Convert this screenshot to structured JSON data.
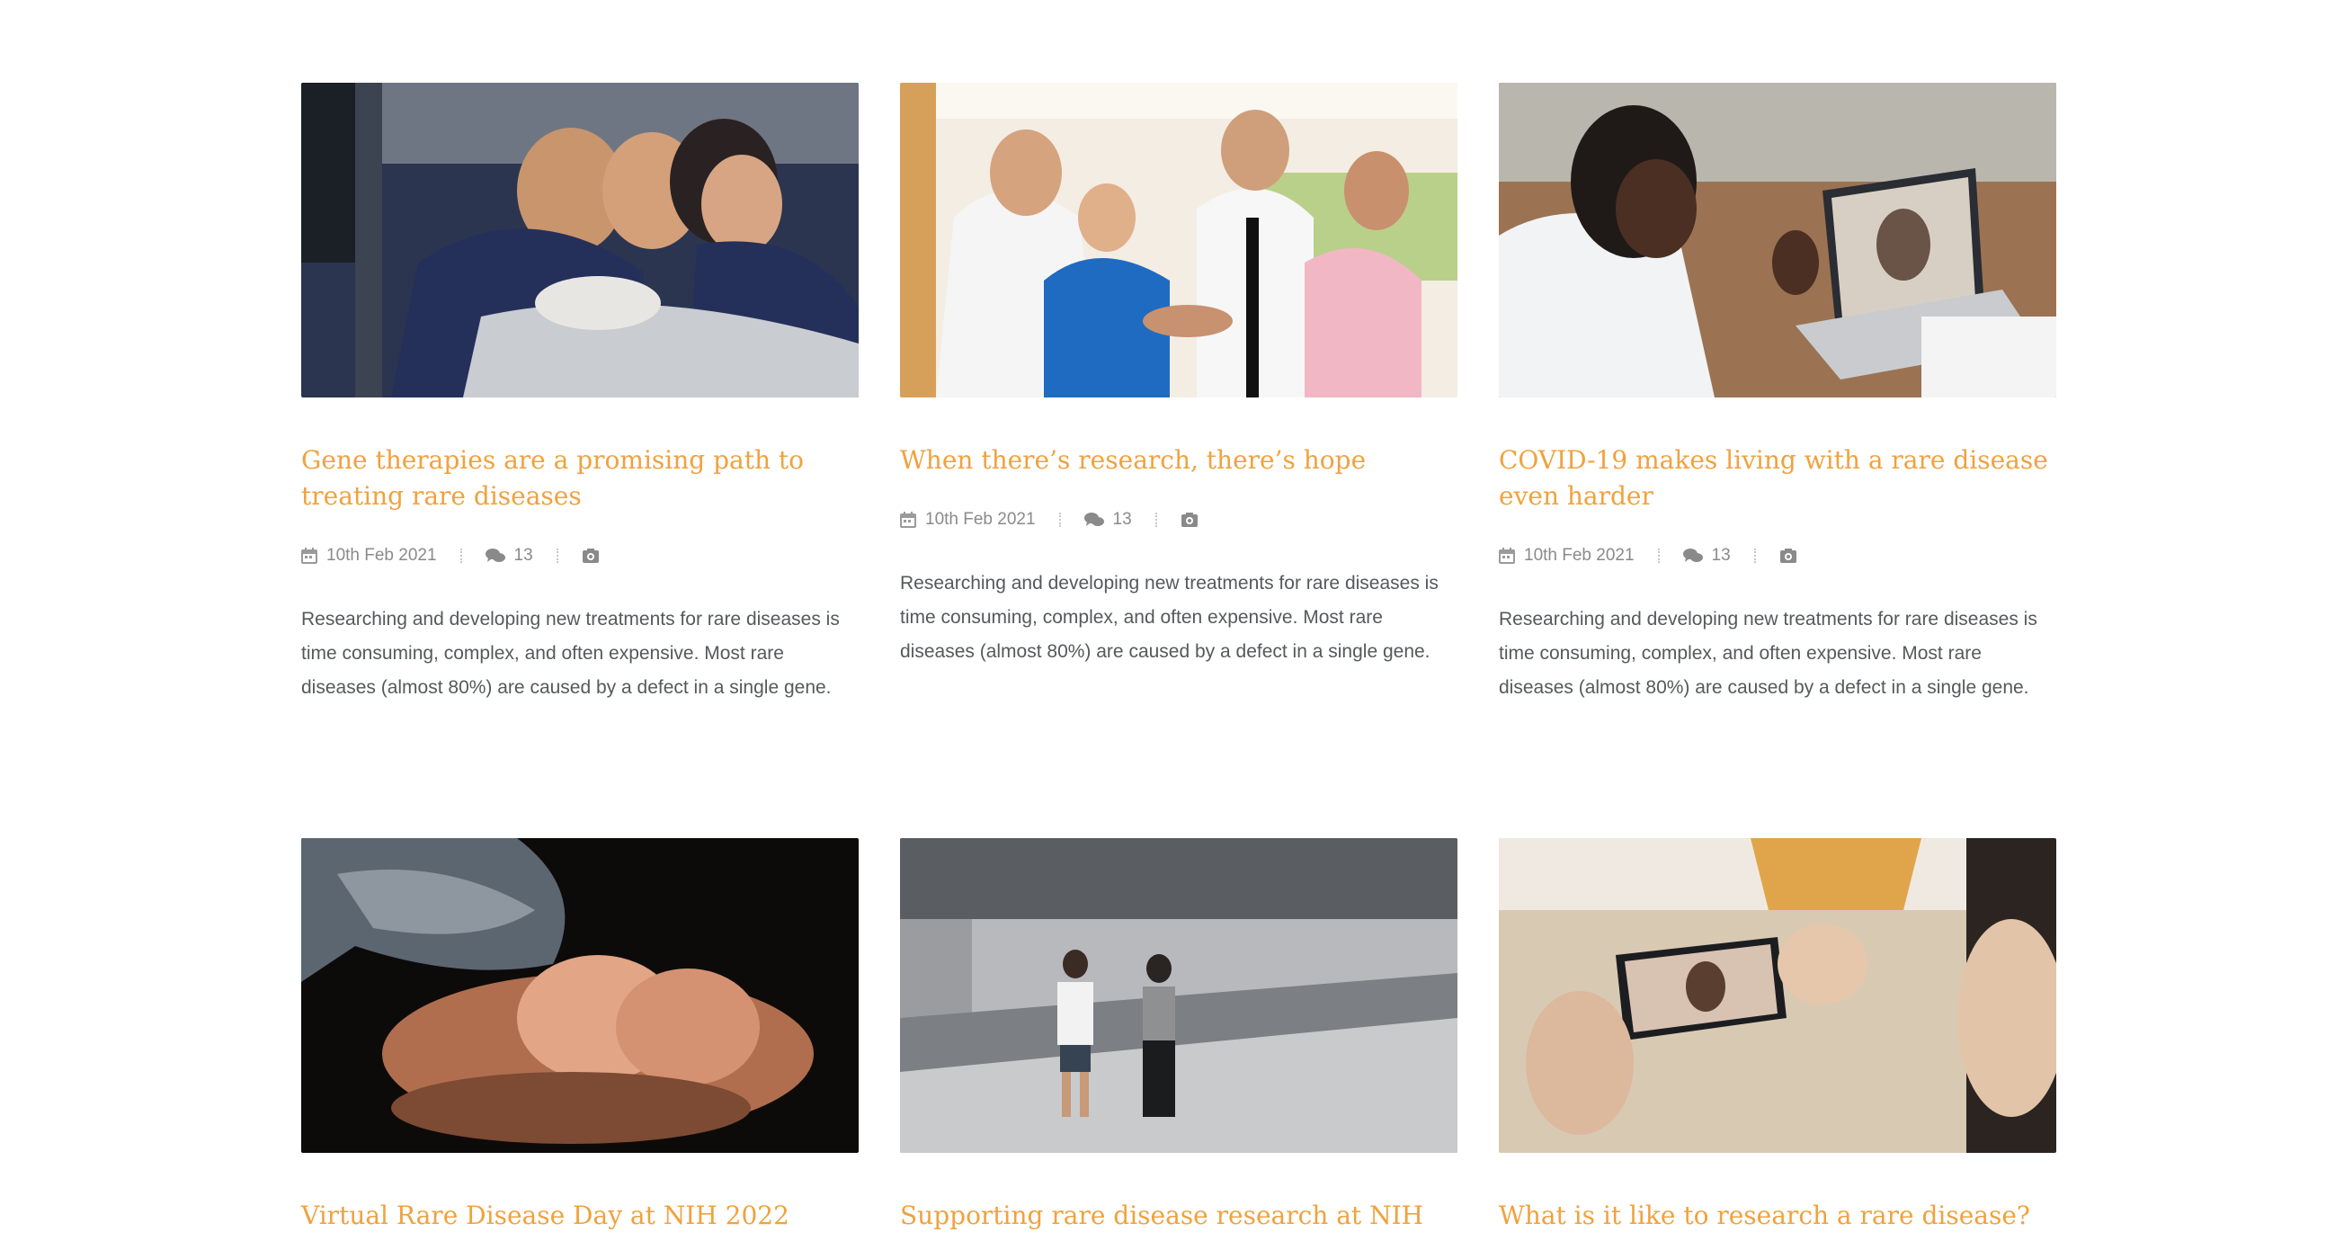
{
  "posts": [
    {
      "title": "Gene therapies are a promising path to treating rare diseases",
      "date": "10th Feb 2021",
      "comments": "13",
      "excerpt": "Researching and developing new treatments for rare diseases is time consuming, complex, and often expensive. Most rare diseases (almost 80%) are caused by a defect in a single gene.",
      "image_alt": "Family hugging a smiling child in a hospital bed"
    },
    {
      "title": "When there’s research, there’s hope",
      "date": "10th Feb 2021",
      "comments": "13",
      "excerpt": "Researching and developing new treatments for rare diseases is time consuming, complex, and often expensive. Most rare diseases (almost 80%) are caused by a defect in a single gene.",
      "image_alt": "Medical team stacking hands together in a hospital corridor"
    },
    {
      "title": "COVID-19 makes living with a rare disease even harder",
      "date": "10th Feb 2021",
      "comments": "13",
      "excerpt": "Researching and developing new treatments for rare diseases is time consuming, complex, and often expensive. Most rare diseases (almost 80%) are caused by a defect in a single gene.",
      "image_alt": "Doctor on a video call with a patient on a laptop"
    },
    {
      "title": "Virtual Rare Disease Day at NIH 2022",
      "image_alt": "Baby feet held in an adult's hands"
    },
    {
      "title": "Supporting rare disease research at NIH",
      "image_alt": "Two people wearing masks walking outdoors"
    },
    {
      "title": "What is it like to research a rare disease?",
      "image_alt": "Person on a video call on a smartphone"
    }
  ],
  "colors": {
    "title": "#f0a23e",
    "meta": "#8a8a8a",
    "excerpt": "#55595c"
  },
  "icons": {
    "date": "calendar-icon",
    "comments": "comments-icon",
    "category": "camera-icon"
  }
}
